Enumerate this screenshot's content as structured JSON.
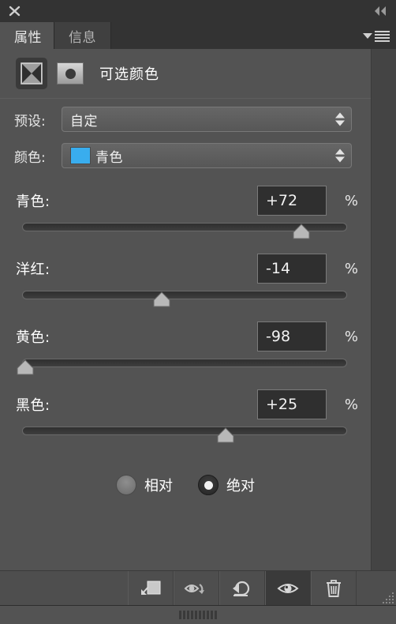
{
  "window": {
    "close_icon": "close-icon",
    "collapse_icon": "collapse-double-chevron-left-icon"
  },
  "tabs": [
    {
      "label": "属性",
      "active": true
    },
    {
      "label": "信息",
      "active": false
    }
  ],
  "panel_menu": {
    "icon": "panel-menu-hamburger-icon"
  },
  "adjustment": {
    "layer_icon": "selective-color-adjustment-icon",
    "mask_icon": "layer-mask-thumbnail-icon",
    "title": "可选颜色"
  },
  "dropdowns": [
    {
      "label": "预设:",
      "value": "自定",
      "has_swatch": false,
      "swatch_color": ""
    },
    {
      "label": "颜色:",
      "value": "青色",
      "has_swatch": true,
      "swatch_color": "#39ADEE"
    }
  ],
  "sliders": [
    {
      "label": "青色:",
      "value": "+72",
      "unit": "%",
      "number": 72,
      "min": -100,
      "max": 100
    },
    {
      "label": "洋红:",
      "value": "-14",
      "unit": "%",
      "number": -14,
      "min": -100,
      "max": 100
    },
    {
      "label": "黄色:",
      "value": "-98",
      "unit": "%",
      "number": -98,
      "min": -100,
      "max": 100
    },
    {
      "label": "黑色:",
      "value": "+25",
      "unit": "%",
      "number": 25,
      "min": -100,
      "max": 100
    }
  ],
  "radio_options": [
    {
      "label": "相对",
      "selected": false
    },
    {
      "label": "绝对",
      "selected": true
    }
  ],
  "footer_buttons": [
    {
      "icon": "clip-to-layer-icon",
      "active": false
    },
    {
      "icon": "toggle-layer-visibility-icon",
      "active": false
    },
    {
      "icon": "reset-adjustment-icon",
      "active": false
    },
    {
      "icon": "eye-visibility-icon",
      "active": true
    },
    {
      "icon": "delete-trash-icon",
      "active": false
    }
  ],
  "colors": {
    "panel_bg": "#535353",
    "header_bg": "#333333",
    "footer_bg": "#4e4e4e",
    "value_field_bg": "#2f2f2f",
    "accent_swatch": "#39ADEE"
  }
}
